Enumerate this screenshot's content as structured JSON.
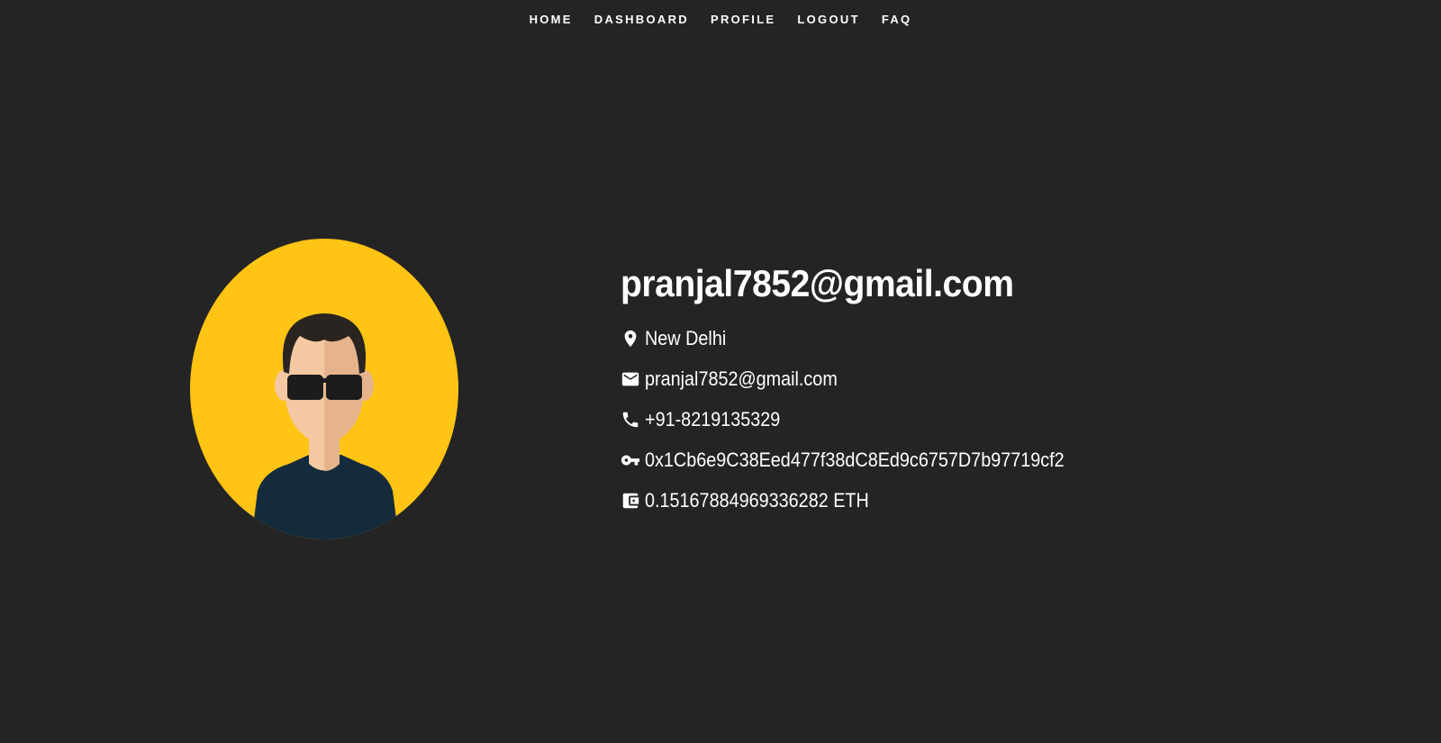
{
  "nav": {
    "items": [
      {
        "label": "HOME"
      },
      {
        "label": "DASHBOARD"
      },
      {
        "label": "PROFILE"
      },
      {
        "label": "LOGOUT"
      },
      {
        "label": "FAQ"
      }
    ]
  },
  "profile": {
    "title": "pranjal7852@gmail.com",
    "location": "New Delhi",
    "email": "pranjal7852@gmail.com",
    "phone": "+91-8219135329",
    "wallet_address": "0x1Cb6e9C38Eed477f38dC8Ed9c6757D7b97719cf2",
    "balance": "0.15167884969336282 ETH"
  },
  "icons": {
    "location": "location-pin-icon",
    "email": "email-icon",
    "phone": "phone-icon",
    "key": "key-icon",
    "wallet": "wallet-icon"
  },
  "colors": {
    "background": "#242424",
    "text": "#ffffff",
    "avatar_bg": "#FFC414",
    "shirt": "#142B3D",
    "skin": "#F4C8A0",
    "hair": "#2A2420"
  }
}
